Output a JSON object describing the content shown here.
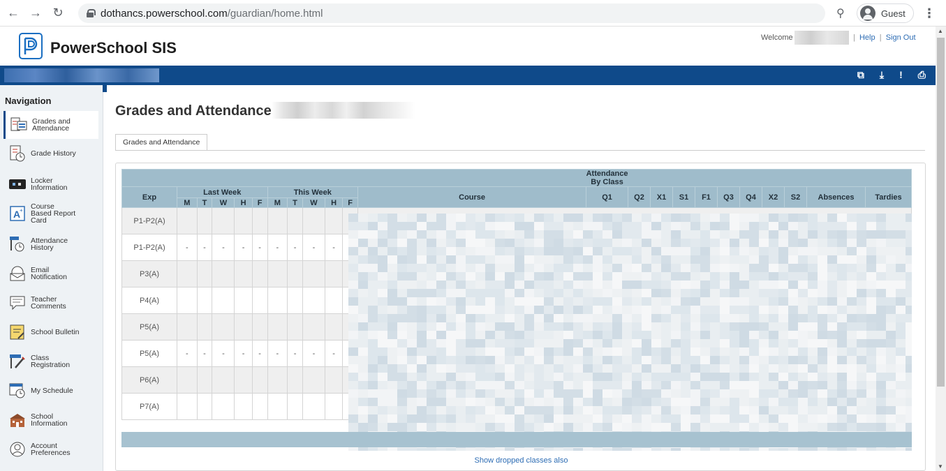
{
  "browser": {
    "url_host": "dothancs.powerschool.com",
    "url_path": "/guardian/home.html",
    "profile_label": "Guest"
  },
  "header": {
    "app_name": "PowerSchool SIS",
    "welcome_label": "Welcome",
    "help_link": "Help",
    "signout_link": "Sign Out",
    "separator": "|"
  },
  "sidebar": {
    "title": "Navigation",
    "items": [
      {
        "label": "Grades and\nAttendance",
        "icon": "grades-attendance-icon"
      },
      {
        "label": "Grade History",
        "icon": "grade-history-icon"
      },
      {
        "label": "Locker\nInformation",
        "icon": "locker-icon"
      },
      {
        "label": "Course\nBased Report\nCard",
        "icon": "report-card-icon"
      },
      {
        "label": "Attendance\nHistory",
        "icon": "attendance-history-icon"
      },
      {
        "label": "Email\nNotification",
        "icon": "email-icon"
      },
      {
        "label": "Teacher\nComments",
        "icon": "comments-icon"
      },
      {
        "label": "School Bulletin",
        "icon": "bulletin-icon"
      },
      {
        "label": "Class\nRegistration",
        "icon": "registration-icon"
      },
      {
        "label": "My Schedule",
        "icon": "schedule-icon"
      },
      {
        "label": "School\nInformation",
        "icon": "school-icon"
      },
      {
        "label": "Account\nPreferences",
        "icon": "account-icon"
      }
    ]
  },
  "main": {
    "title": "Grades and Attendance:",
    "tab_label": "Grades and Attendance",
    "show_dropped_link": "Show dropped classes also"
  },
  "table": {
    "caption": "Attendance By Class",
    "exp_header": "Exp",
    "last_week_header": "Last Week",
    "this_week_header": "This Week",
    "days": [
      "M",
      "T",
      "W",
      "H",
      "F"
    ],
    "course_header": "Course",
    "term_headers": [
      "Q1",
      "Q2",
      "X1",
      "S1",
      "F1",
      "Q3",
      "Q4",
      "X2",
      "S2"
    ],
    "absences_header": "Absences",
    "tardies_header": "Tardies",
    "rows": [
      {
        "exp": "P1-P2(A)",
        "days": [
          "",
          "",
          "",
          "",
          "",
          "",
          "",
          "",
          "",
          ""
        ]
      },
      {
        "exp": "P1-P2(A)",
        "days": [
          "-",
          "-",
          "-",
          "-",
          "-",
          "-",
          "-",
          "-",
          "-",
          "-"
        ]
      },
      {
        "exp": "P3(A)",
        "days": [
          "",
          "",
          "",
          "",
          "",
          "",
          "",
          "",
          "",
          ""
        ]
      },
      {
        "exp": "P4(A)",
        "days": [
          "",
          "",
          "",
          "",
          "",
          "",
          "",
          "",
          "",
          ""
        ]
      },
      {
        "exp": "P5(A)",
        "days": [
          "",
          "",
          "",
          "",
          "",
          "",
          "",
          "",
          "",
          ""
        ]
      },
      {
        "exp": "P5(A)",
        "days": [
          "-",
          "-",
          "-",
          "-",
          "-",
          "-",
          "-",
          "-",
          "-",
          "-"
        ]
      },
      {
        "exp": "P6(A)",
        "days": [
          "",
          "",
          "",
          "",
          "",
          "",
          "",
          "",
          "",
          ""
        ]
      },
      {
        "exp": "P7(A)",
        "days": [
          "",
          "",
          "",
          "",
          "",
          "",
          "",
          "",
          "",
          ""
        ]
      }
    ]
  }
}
